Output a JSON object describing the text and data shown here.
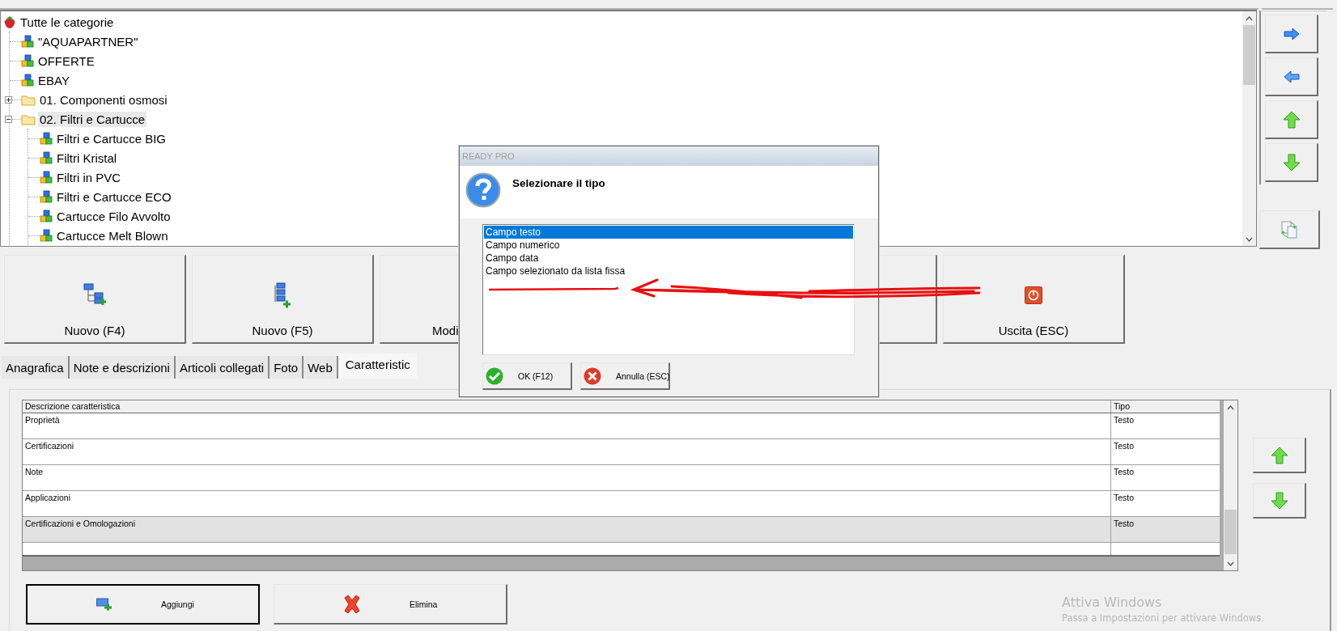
{
  "tree": {
    "items": [
      {
        "label": "Tutte le categorie",
        "kind": "root",
        "selected": false,
        "children": [
          {
            "label": "\"AQUAPARTNER\"",
            "kind": "category",
            "selected": false
          },
          {
            "label": "OFFERTE",
            "kind": "category",
            "selected": false
          },
          {
            "label": "EBAY",
            "kind": "category",
            "selected": false
          },
          {
            "label": "01. Componenti osmosi",
            "kind": "folder",
            "selected": false,
            "expanded": false
          },
          {
            "label": "02. Filtri e Cartucce",
            "kind": "folder",
            "selected": true,
            "expanded": true,
            "children": [
              {
                "label": "Filtri e Cartucce BIG",
                "kind": "category",
                "selected": false
              },
              {
                "label": "Filtri Kristal",
                "kind": "category",
                "selected": false
              },
              {
                "label": "Filtri in PVC",
                "kind": "category",
                "selected": false
              },
              {
                "label": "Filtri e Cartucce ECO",
                "kind": "category",
                "selected": false
              },
              {
                "label": "Cartucce Filo Avvolto",
                "kind": "category",
                "selected": false
              },
              {
                "label": "Cartucce Melt Blown",
                "kind": "category",
                "selected": false
              }
            ]
          }
        ]
      }
    ]
  },
  "big_buttons": [
    {
      "label": "Nuovo (F4)"
    },
    {
      "label": "Nuovo (F5)"
    },
    {
      "label": "Modi"
    },
    {
      "label": "Uscita (ESC)"
    }
  ],
  "tabs": [
    {
      "label": "Anagrafica",
      "selected": false
    },
    {
      "label": "Note e descrizioni",
      "selected": false
    },
    {
      "label": "Articoli collegati",
      "selected": false
    },
    {
      "label": "Foto",
      "selected": false
    },
    {
      "label": "Web",
      "selected": false
    },
    {
      "label": "Caratteristic",
      "selected": true
    }
  ],
  "characteristics": {
    "columns": [
      "Descrizione caratteristica",
      "Tipo"
    ],
    "rows": [
      {
        "cells": [
          "Proprietà",
          "Testo"
        ],
        "selected": false
      },
      {
        "cells": [
          "Certificazioni",
          "Testo"
        ],
        "selected": false
      },
      {
        "cells": [
          "Note",
          "Testo"
        ],
        "selected": false
      },
      {
        "cells": [
          "Applicazioni",
          "Testo"
        ],
        "selected": false
      },
      {
        "cells": [
          "Certificazioni e Omologazioni",
          "Testo"
        ],
        "selected": true
      }
    ]
  },
  "actions": [
    {
      "label": "Aggiungi",
      "focused": true
    },
    {
      "label": "Elimina",
      "focused": false
    }
  ],
  "dialog": {
    "title": "READY PRO",
    "heading": "Selezionare il tipo",
    "options": [
      {
        "label": "Campo testo",
        "selected": true
      },
      {
        "label": "Campo numerico",
        "selected": false
      },
      {
        "label": "Campo data",
        "selected": false
      },
      {
        "label": "Campo selezionato da lista fissa",
        "selected": false
      }
    ],
    "buttons": [
      {
        "label": "OK (F12)"
      },
      {
        "label": "Annulla (ESC)"
      }
    ]
  },
  "system_notice": {
    "title": "Attiva Windows",
    "text": "Passa a Impostazioni per attivare Windows."
  }
}
